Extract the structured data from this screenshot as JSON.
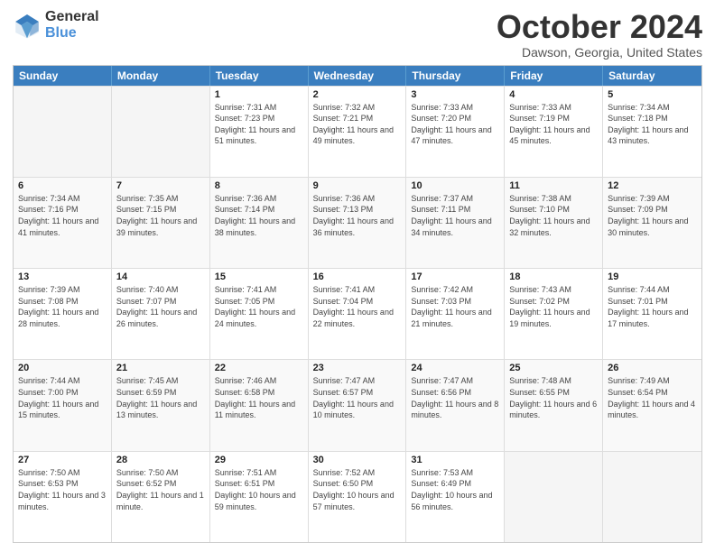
{
  "logo": {
    "general": "General",
    "blue": "Blue"
  },
  "title": {
    "month_year": "October 2024",
    "location": "Dawson, Georgia, United States"
  },
  "days_of_week": [
    "Sunday",
    "Monday",
    "Tuesday",
    "Wednesday",
    "Thursday",
    "Friday",
    "Saturday"
  ],
  "weeks": [
    [
      {
        "day": "",
        "sunrise": "",
        "sunset": "",
        "daylight": "",
        "empty": true
      },
      {
        "day": "",
        "sunrise": "",
        "sunset": "",
        "daylight": "",
        "empty": true
      },
      {
        "day": "1",
        "sunrise": "Sunrise: 7:31 AM",
        "sunset": "Sunset: 7:23 PM",
        "daylight": "Daylight: 11 hours and 51 minutes.",
        "empty": false
      },
      {
        "day": "2",
        "sunrise": "Sunrise: 7:32 AM",
        "sunset": "Sunset: 7:21 PM",
        "daylight": "Daylight: 11 hours and 49 minutes.",
        "empty": false
      },
      {
        "day": "3",
        "sunrise": "Sunrise: 7:33 AM",
        "sunset": "Sunset: 7:20 PM",
        "daylight": "Daylight: 11 hours and 47 minutes.",
        "empty": false
      },
      {
        "day": "4",
        "sunrise": "Sunrise: 7:33 AM",
        "sunset": "Sunset: 7:19 PM",
        "daylight": "Daylight: 11 hours and 45 minutes.",
        "empty": false
      },
      {
        "day": "5",
        "sunrise": "Sunrise: 7:34 AM",
        "sunset": "Sunset: 7:18 PM",
        "daylight": "Daylight: 11 hours and 43 minutes.",
        "empty": false
      }
    ],
    [
      {
        "day": "6",
        "sunrise": "Sunrise: 7:34 AM",
        "sunset": "Sunset: 7:16 PM",
        "daylight": "Daylight: 11 hours and 41 minutes.",
        "empty": false
      },
      {
        "day": "7",
        "sunrise": "Sunrise: 7:35 AM",
        "sunset": "Sunset: 7:15 PM",
        "daylight": "Daylight: 11 hours and 39 minutes.",
        "empty": false
      },
      {
        "day": "8",
        "sunrise": "Sunrise: 7:36 AM",
        "sunset": "Sunset: 7:14 PM",
        "daylight": "Daylight: 11 hours and 38 minutes.",
        "empty": false
      },
      {
        "day": "9",
        "sunrise": "Sunrise: 7:36 AM",
        "sunset": "Sunset: 7:13 PM",
        "daylight": "Daylight: 11 hours and 36 minutes.",
        "empty": false
      },
      {
        "day": "10",
        "sunrise": "Sunrise: 7:37 AM",
        "sunset": "Sunset: 7:11 PM",
        "daylight": "Daylight: 11 hours and 34 minutes.",
        "empty": false
      },
      {
        "day": "11",
        "sunrise": "Sunrise: 7:38 AM",
        "sunset": "Sunset: 7:10 PM",
        "daylight": "Daylight: 11 hours and 32 minutes.",
        "empty": false
      },
      {
        "day": "12",
        "sunrise": "Sunrise: 7:39 AM",
        "sunset": "Sunset: 7:09 PM",
        "daylight": "Daylight: 11 hours and 30 minutes.",
        "empty": false
      }
    ],
    [
      {
        "day": "13",
        "sunrise": "Sunrise: 7:39 AM",
        "sunset": "Sunset: 7:08 PM",
        "daylight": "Daylight: 11 hours and 28 minutes.",
        "empty": false
      },
      {
        "day": "14",
        "sunrise": "Sunrise: 7:40 AM",
        "sunset": "Sunset: 7:07 PM",
        "daylight": "Daylight: 11 hours and 26 minutes.",
        "empty": false
      },
      {
        "day": "15",
        "sunrise": "Sunrise: 7:41 AM",
        "sunset": "Sunset: 7:05 PM",
        "daylight": "Daylight: 11 hours and 24 minutes.",
        "empty": false
      },
      {
        "day": "16",
        "sunrise": "Sunrise: 7:41 AM",
        "sunset": "Sunset: 7:04 PM",
        "daylight": "Daylight: 11 hours and 22 minutes.",
        "empty": false
      },
      {
        "day": "17",
        "sunrise": "Sunrise: 7:42 AM",
        "sunset": "Sunset: 7:03 PM",
        "daylight": "Daylight: 11 hours and 21 minutes.",
        "empty": false
      },
      {
        "day": "18",
        "sunrise": "Sunrise: 7:43 AM",
        "sunset": "Sunset: 7:02 PM",
        "daylight": "Daylight: 11 hours and 19 minutes.",
        "empty": false
      },
      {
        "day": "19",
        "sunrise": "Sunrise: 7:44 AM",
        "sunset": "Sunset: 7:01 PM",
        "daylight": "Daylight: 11 hours and 17 minutes.",
        "empty": false
      }
    ],
    [
      {
        "day": "20",
        "sunrise": "Sunrise: 7:44 AM",
        "sunset": "Sunset: 7:00 PM",
        "daylight": "Daylight: 11 hours and 15 minutes.",
        "empty": false
      },
      {
        "day": "21",
        "sunrise": "Sunrise: 7:45 AM",
        "sunset": "Sunset: 6:59 PM",
        "daylight": "Daylight: 11 hours and 13 minutes.",
        "empty": false
      },
      {
        "day": "22",
        "sunrise": "Sunrise: 7:46 AM",
        "sunset": "Sunset: 6:58 PM",
        "daylight": "Daylight: 11 hours and 11 minutes.",
        "empty": false
      },
      {
        "day": "23",
        "sunrise": "Sunrise: 7:47 AM",
        "sunset": "Sunset: 6:57 PM",
        "daylight": "Daylight: 11 hours and 10 minutes.",
        "empty": false
      },
      {
        "day": "24",
        "sunrise": "Sunrise: 7:47 AM",
        "sunset": "Sunset: 6:56 PM",
        "daylight": "Daylight: 11 hours and 8 minutes.",
        "empty": false
      },
      {
        "day": "25",
        "sunrise": "Sunrise: 7:48 AM",
        "sunset": "Sunset: 6:55 PM",
        "daylight": "Daylight: 11 hours and 6 minutes.",
        "empty": false
      },
      {
        "day": "26",
        "sunrise": "Sunrise: 7:49 AM",
        "sunset": "Sunset: 6:54 PM",
        "daylight": "Daylight: 11 hours and 4 minutes.",
        "empty": false
      }
    ],
    [
      {
        "day": "27",
        "sunrise": "Sunrise: 7:50 AM",
        "sunset": "Sunset: 6:53 PM",
        "daylight": "Daylight: 11 hours and 3 minutes.",
        "empty": false
      },
      {
        "day": "28",
        "sunrise": "Sunrise: 7:50 AM",
        "sunset": "Sunset: 6:52 PM",
        "daylight": "Daylight: 11 hours and 1 minute.",
        "empty": false
      },
      {
        "day": "29",
        "sunrise": "Sunrise: 7:51 AM",
        "sunset": "Sunset: 6:51 PM",
        "daylight": "Daylight: 10 hours and 59 minutes.",
        "empty": false
      },
      {
        "day": "30",
        "sunrise": "Sunrise: 7:52 AM",
        "sunset": "Sunset: 6:50 PM",
        "daylight": "Daylight: 10 hours and 57 minutes.",
        "empty": false
      },
      {
        "day": "31",
        "sunrise": "Sunrise: 7:53 AM",
        "sunset": "Sunset: 6:49 PM",
        "daylight": "Daylight: 10 hours and 56 minutes.",
        "empty": false
      },
      {
        "day": "",
        "sunrise": "",
        "sunset": "",
        "daylight": "",
        "empty": true
      },
      {
        "day": "",
        "sunrise": "",
        "sunset": "",
        "daylight": "",
        "empty": true
      }
    ]
  ]
}
